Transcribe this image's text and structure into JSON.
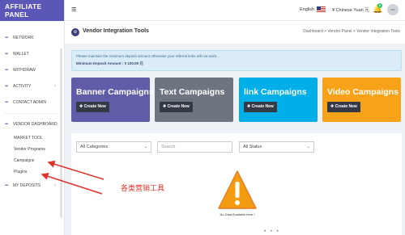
{
  "sidebar": {
    "brand": "AFFILIATE PANEL",
    "items": [
      {
        "label": "NETWORK",
        "dots": "•••"
      },
      {
        "label": "WALLET",
        "dots": "•••"
      },
      {
        "label": "WITHDRAW",
        "dots": "•••"
      },
      {
        "label": "ACTIVITY",
        "dots": "•••",
        "chevron": "›"
      },
      {
        "label": "CONTACT ADMIN",
        "dots": "•••"
      }
    ],
    "vendor_dashboard": {
      "label": "VENDOR DASHBOARD",
      "dots": "•••"
    },
    "sub_items": [
      {
        "label": "MARKET TOOL"
      },
      {
        "label": "Vendor Programs"
      },
      {
        "label": "Campaigns"
      },
      {
        "label": "Plugins"
      }
    ],
    "my_deposits": {
      "label": "MY DEPOSITS",
      "dots": "•••",
      "chevron": "›"
    }
  },
  "topbar": {
    "hamburger": "≡",
    "language": "English",
    "currency": "¥ Chinese Yuan 元",
    "bell": "🔔",
    "bell_badge": "0",
    "avatar": "user"
  },
  "header": {
    "icon": "⚙",
    "title": "Vendor Integration Tools",
    "breadcrumb": "Dashboard  >  Vendor Panel  >  Vendor Integration Tools"
  },
  "notice": {
    "text": "Please maintain the minimum deposit amount otherwise your referral links will not work...",
    "min_deposit": "Minimum Deposit Amount : ¥ 100.00 元"
  },
  "cards": [
    {
      "title": "Banner Campaigns",
      "button": "✚ Create New",
      "color": "#605ca8"
    },
    {
      "title": "Text Campaigns",
      "button": "✚ Create New",
      "color": "#6e7480"
    },
    {
      "title": "link Campaigns",
      "button": "✚ Create New",
      "color": "#00aee8"
    },
    {
      "title": "Video Campaigns",
      "button": "✚ Create New",
      "color": "#f8a21a"
    }
  ],
  "filters": {
    "category": "All Categories",
    "search_placeholder": "Search",
    "status": "All Status",
    "chevron": "⌄"
  },
  "empty_state": {
    "icon": "warning-icon",
    "text": "No Data Available here !",
    "loading": "• • •"
  },
  "annotation": {
    "text": "各类营销工具",
    "color": "#e0322c"
  }
}
